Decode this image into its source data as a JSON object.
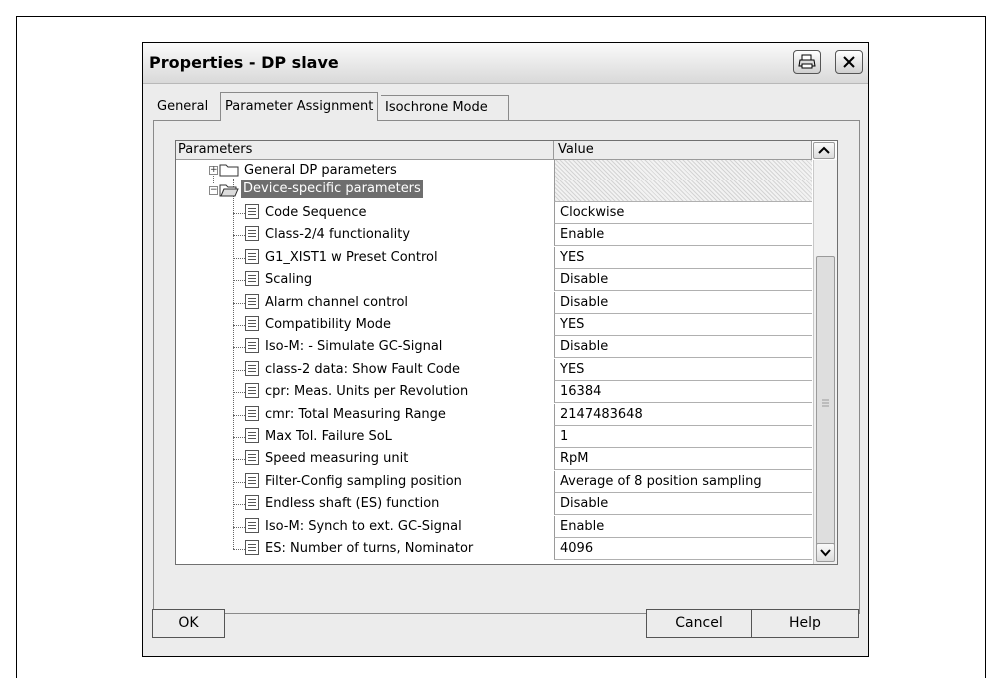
{
  "dialog": {
    "title": "Properties - DP slave",
    "title_icons": [
      "printer-icon",
      "close-icon"
    ]
  },
  "tabs": [
    {
      "label": "General",
      "active": false
    },
    {
      "label": "Parameter Assignment",
      "active": true
    },
    {
      "label": "Isochrone Mode",
      "active": false
    }
  ],
  "table": {
    "columns": [
      "Parameters",
      "Value"
    ],
    "groups": [
      {
        "label": "General DP parameters",
        "expanded": false,
        "value": ""
      },
      {
        "label": "Device-specific parameters",
        "expanded": true,
        "value": "",
        "selected": true
      }
    ],
    "rows": [
      {
        "name": "Code Sequence",
        "value": "Clockwise"
      },
      {
        "name": "Class-2/4 functionality",
        "value": "Enable"
      },
      {
        "name": "G1_XIST1 w Preset Control",
        "value": "YES"
      },
      {
        "name": "Scaling",
        "value": "Disable"
      },
      {
        "name": "Alarm channel control",
        "value": "Disable"
      },
      {
        "name": "Compatibility Mode",
        "value": "YES"
      },
      {
        "name": "Iso-M: - Simulate GC-Signal",
        "value": "Disable"
      },
      {
        "name": "class-2 data: Show Fault Code",
        "value": "YES"
      },
      {
        "name": "cpr: Meas. Units per Revolution",
        "value": "16384"
      },
      {
        "name": "cmr: Total Measuring Range",
        "value": "2147483648"
      },
      {
        "name": "Max Tol. Failure SoL",
        "value": "1"
      },
      {
        "name": "Speed measuring unit",
        "value": "RpM"
      },
      {
        "name": "Filter-Config sampling position",
        "value": "Average of 8 position sampling"
      },
      {
        "name": "Endless shaft (ES) function",
        "value": "Disable"
      },
      {
        "name": "Iso-M: Synch to ext. GC-Signal",
        "value": "Enable"
      },
      {
        "name": "ES: Number of turns, Nominator",
        "value": "4096"
      }
    ]
  },
  "buttons": {
    "ok": "OK",
    "cancel": "Cancel",
    "help": "Help"
  }
}
